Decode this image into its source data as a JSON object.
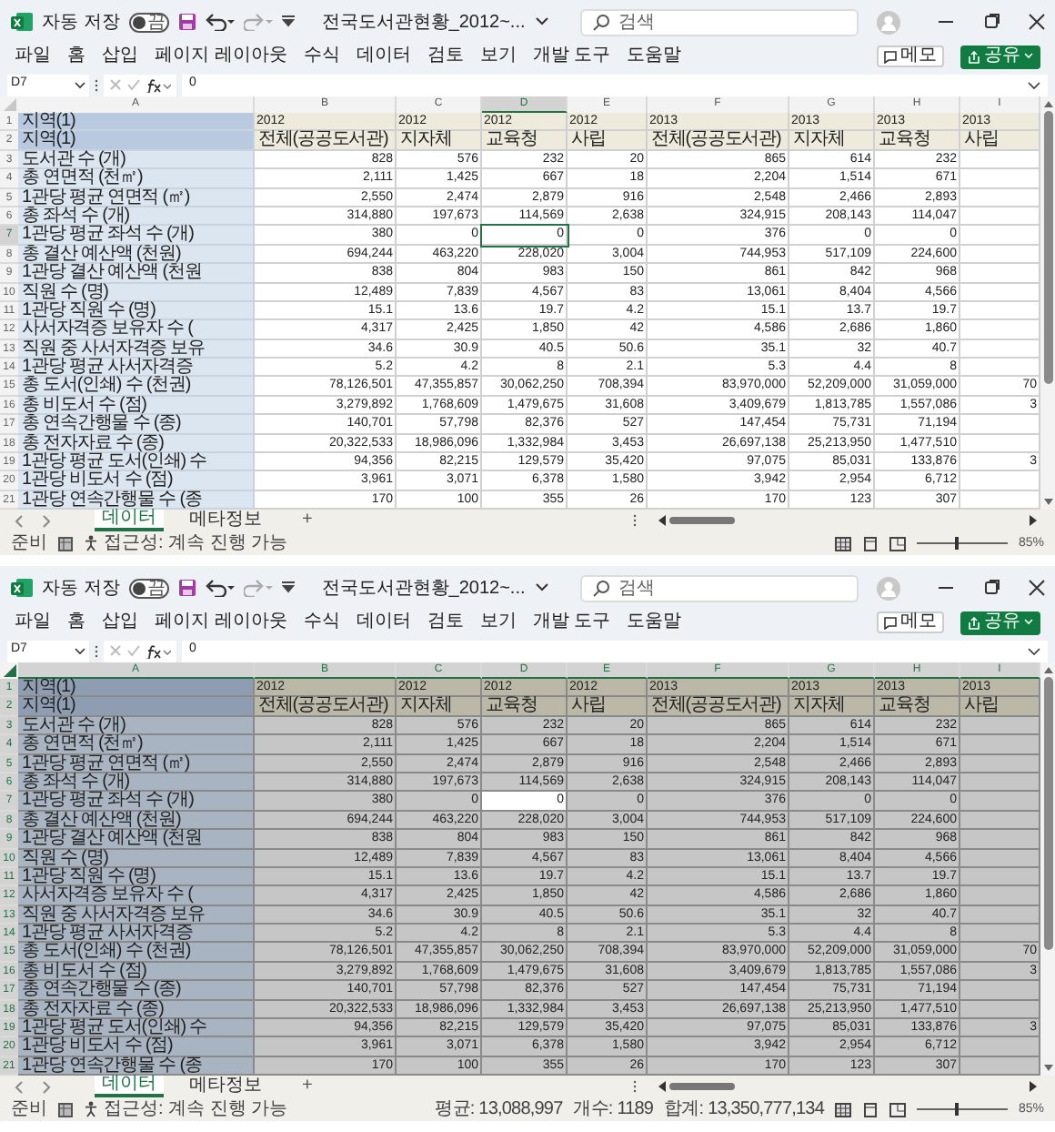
{
  "windows": [
    {
      "title_bar": {
        "autosave_label": "자동 저장",
        "autosave": {
          "on": false,
          "label": "끔"
        },
        "file_name": "전국도서관현황_2012~...",
        "search": {
          "placeholder": "검색"
        }
      },
      "menu": [
        "파일",
        "홈",
        "삽입",
        "페이지 레이아웃",
        "수식",
        "데이터",
        "검토",
        "보기",
        "개발 도구",
        "도움말"
      ],
      "memo_button": "메모",
      "share_button": "공유",
      "name_box": "D7",
      "formula": "0",
      "select_all": false,
      "columns": [
        "A",
        "B",
        "C",
        "D",
        "E",
        "F",
        "G",
        "H",
        "I"
      ],
      "rows": [
        {
          "number": "1",
          "kind": "year_header",
          "label": "지역(1)",
          "cells": [
            "2012",
            "2012",
            "2012",
            "2012",
            "2013",
            "2013",
            "2013",
            "2013"
          ]
        },
        {
          "number": "2",
          "kind": "type_header",
          "label": "지역(1)",
          "cells": [
            "전체(공공도서관)",
            "지자체",
            "교육청",
            "사립",
            "전체(공공도서관)",
            "지자체",
            "교육청",
            "사립"
          ]
        },
        {
          "number": "3",
          "kind": "data",
          "label": "도서관 수 (개)",
          "cells": [
            "828",
            "576",
            "232",
            "20",
            "865",
            "614",
            "232",
            null
          ]
        },
        {
          "number": "4",
          "kind": "data",
          "label": "총 연면적 (천㎡)",
          "cells": [
            "2,111",
            "1,425",
            "667",
            "18",
            "2,204",
            "1,514",
            "671",
            null
          ]
        },
        {
          "number": "5",
          "kind": "data",
          "label": "1관당 평균 연면적 (㎡)",
          "cells": [
            "2,550",
            "2,474",
            "2,879",
            "916",
            "2,548",
            "2,466",
            "2,893",
            null
          ]
        },
        {
          "number": "6",
          "kind": "data",
          "label": "총 좌석 수 (개)",
          "cells": [
            "314,880",
            "197,673",
            "114,569",
            "2,638",
            "324,915",
            "208,143",
            "114,047",
            null
          ]
        },
        {
          "number": "7",
          "kind": "data",
          "label": "1관당 평균 좌석 수 (개)",
          "cells": [
            "380",
            "0",
            "0",
            "0",
            "376",
            "0",
            "0",
            null
          ]
        },
        {
          "number": "8",
          "kind": "data",
          "label": "총 결산 예산액 (천원)",
          "cells": [
            "694,244",
            "463,220",
            "228,020",
            "3,004",
            "744,953",
            "517,109",
            "224,600",
            null
          ]
        },
        {
          "number": "9",
          "kind": "data",
          "label": "1관당 결산 예산액 (천원",
          "cells": [
            "838",
            "804",
            "983",
            "150",
            "861",
            "842",
            "968",
            null
          ]
        },
        {
          "number": "10",
          "kind": "data",
          "label": "직원 수 (명)",
          "cells": [
            "12,489",
            "7,839",
            "4,567",
            "83",
            "13,061",
            "8,404",
            "4,566",
            null
          ]
        },
        {
          "number": "11",
          "kind": "data",
          "label": "1관당 직원 수 (명)",
          "cells": [
            "15.1",
            "13.6",
            "19.7",
            "4.2",
            "15.1",
            "13.7",
            "19.7",
            null
          ]
        },
        {
          "number": "12",
          "kind": "data",
          "label": "사서자격증 보유자 수 (",
          "cells": [
            "4,317",
            "2,425",
            "1,850",
            "42",
            "4,586",
            "2,686",
            "1,860",
            null
          ]
        },
        {
          "number": "13",
          "kind": "data",
          "label": "직원 중 사서자격증 보유",
          "cells": [
            "34.6",
            "30.9",
            "40.5",
            "50.6",
            "35.1",
            "32",
            "40.7",
            null
          ]
        },
        {
          "number": "14",
          "kind": "data",
          "label": "1관당 평균 사서자격증",
          "cells": [
            "5.2",
            "4.2",
            "8",
            "2.1",
            "5.3",
            "4.4",
            "8",
            null
          ]
        },
        {
          "number": "15",
          "kind": "data",
          "label": "총 도서(인쇄) 수 (천권)",
          "cells": [
            "78,126,501",
            "47,355,857",
            "30,062,250",
            "708,394",
            "83,970,000",
            "52,209,000",
            "31,059,000",
            "70"
          ]
        },
        {
          "number": "16",
          "kind": "data",
          "label": "총 비도서 수 (점)",
          "cells": [
            "3,279,892",
            "1,768,609",
            "1,479,675",
            "31,608",
            "3,409,679",
            "1,813,785",
            "1,557,086",
            "3"
          ]
        },
        {
          "number": "17",
          "kind": "data",
          "label": "총 연속간행물 수 (종)",
          "cells": [
            "140,701",
            "57,798",
            "82,376",
            "527",
            "147,454",
            "75,731",
            "71,194",
            null
          ]
        },
        {
          "number": "18",
          "kind": "data",
          "label": "총 전자자료 수 (종)",
          "cells": [
            "20,322,533",
            "18,986,096",
            "1,332,984",
            "3,453",
            "26,697,138",
            "25,213,950",
            "1,477,510",
            null
          ]
        },
        {
          "number": "19",
          "kind": "data",
          "label": "1관당 평균 도서(인쇄) 수",
          "cells": [
            "94,356",
            "82,215",
            "129,579",
            "35,420",
            "97,075",
            "85,031",
            "133,876",
            "3"
          ]
        },
        {
          "number": "20",
          "kind": "data",
          "label": "1관당 비도서 수 (점)",
          "cells": [
            "3,961",
            "3,071",
            "6,378",
            "1,580",
            "3,942",
            "2,954",
            "6,712",
            null
          ]
        },
        {
          "number": "21",
          "kind": "data",
          "label": "1관당 연속간행물 수 (종",
          "cells": [
            "170",
            "100",
            "355",
            "26",
            "170",
            "123",
            "307",
            null
          ]
        }
      ],
      "sheet_tabs": [
        {
          "label": "데이터",
          "selected": true
        },
        {
          "label": "메타정보",
          "selected": false
        }
      ],
      "add_sheet": "+",
      "status": {
        "ready": "준비",
        "accessibility": "접근성: 계속 진행 가능"
      },
      "zoom": {
        "level": 0.42,
        "reading": "85%"
      }
    },
    {
      "title_bar": {
        "autosave_label": "자동 저장",
        "autosave": {
          "on": false,
          "label": "끔"
        },
        "file_name": "전국도서관현황_2012~...",
        "search": {
          "placeholder": "검색"
        }
      },
      "menu": [
        "파일",
        "홈",
        "삽입",
        "페이지 레이아웃",
        "수식",
        "데이터",
        "검토",
        "보기",
        "개발 도구",
        "도움말"
      ],
      "memo_button": "메모",
      "share_button": "공유",
      "name_box": "D7",
      "formula": "0",
      "select_all": true,
      "columns": [
        "A",
        "B",
        "C",
        "D",
        "E",
        "F",
        "G",
        "H",
        "I"
      ],
      "rows": [
        {
          "number": "1",
          "kind": "year_header",
          "label": "지역(1)",
          "cells": [
            "2012",
            "2012",
            "2012",
            "2012",
            "2013",
            "2013",
            "2013",
            "2013"
          ]
        },
        {
          "number": "2",
          "kind": "type_header",
          "label": "지역(1)",
          "cells": [
            "전체(공공도서관)",
            "지자체",
            "교육청",
            "사립",
            "전체(공공도서관)",
            "지자체",
            "교육청",
            "사립"
          ]
        },
        {
          "number": "3",
          "kind": "data",
          "label": "도서관 수 (개)",
          "cells": [
            "828",
            "576",
            "232",
            "20",
            "865",
            "614",
            "232",
            null
          ]
        },
        {
          "number": "4",
          "kind": "data",
          "label": "총 연면적 (천㎡)",
          "cells": [
            "2,111",
            "1,425",
            "667",
            "18",
            "2,204",
            "1,514",
            "671",
            null
          ]
        },
        {
          "number": "5",
          "kind": "data",
          "label": "1관당 평균 연면적 (㎡)",
          "cells": [
            "2,550",
            "2,474",
            "2,879",
            "916",
            "2,548",
            "2,466",
            "2,893",
            null
          ]
        },
        {
          "number": "6",
          "kind": "data",
          "label": "총 좌석 수 (개)",
          "cells": [
            "314,880",
            "197,673",
            "114,569",
            "2,638",
            "324,915",
            "208,143",
            "114,047",
            null
          ]
        },
        {
          "number": "7",
          "kind": "data",
          "label": "1관당 평균 좌석 수 (개)",
          "cells": [
            "380",
            "0",
            "0",
            "0",
            "376",
            "0",
            "0",
            null
          ]
        },
        {
          "number": "8",
          "kind": "data",
          "label": "총 결산 예산액 (천원)",
          "cells": [
            "694,244",
            "463,220",
            "228,020",
            "3,004",
            "744,953",
            "517,109",
            "224,600",
            null
          ]
        },
        {
          "number": "9",
          "kind": "data",
          "label": "1관당 결산 예산액 (천원",
          "cells": [
            "838",
            "804",
            "983",
            "150",
            "861",
            "842",
            "968",
            null
          ]
        },
        {
          "number": "10",
          "kind": "data",
          "label": "직원 수 (명)",
          "cells": [
            "12,489",
            "7,839",
            "4,567",
            "83",
            "13,061",
            "8,404",
            "4,566",
            null
          ]
        },
        {
          "number": "11",
          "kind": "data",
          "label": "1관당 직원 수 (명)",
          "cells": [
            "15.1",
            "13.6",
            "19.7",
            "4.2",
            "15.1",
            "13.7",
            "19.7",
            null
          ]
        },
        {
          "number": "12",
          "kind": "data",
          "label": "사서자격증 보유자 수 (",
          "cells": [
            "4,317",
            "2,425",
            "1,850",
            "42",
            "4,586",
            "2,686",
            "1,860",
            null
          ]
        },
        {
          "number": "13",
          "kind": "data",
          "label": "직원 중 사서자격증 보유",
          "cells": [
            "34.6",
            "30.9",
            "40.5",
            "50.6",
            "35.1",
            "32",
            "40.7",
            null
          ]
        },
        {
          "number": "14",
          "kind": "data",
          "label": "1관당 평균 사서자격증",
          "cells": [
            "5.2",
            "4.2",
            "8",
            "2.1",
            "5.3",
            "4.4",
            "8",
            null
          ]
        },
        {
          "number": "15",
          "kind": "data",
          "label": "총 도서(인쇄) 수 (천권)",
          "cells": [
            "78,126,501",
            "47,355,857",
            "30,062,250",
            "708,394",
            "83,970,000",
            "52,209,000",
            "31,059,000",
            "70"
          ]
        },
        {
          "number": "16",
          "kind": "data",
          "label": "총 비도서 수 (점)",
          "cells": [
            "3,279,892",
            "1,768,609",
            "1,479,675",
            "31,608",
            "3,409,679",
            "1,813,785",
            "1,557,086",
            "3"
          ]
        },
        {
          "number": "17",
          "kind": "data",
          "label": "총 연속간행물 수 (종)",
          "cells": [
            "140,701",
            "57,798",
            "82,376",
            "527",
            "147,454",
            "75,731",
            "71,194",
            null
          ]
        },
        {
          "number": "18",
          "kind": "data",
          "label": "총 전자자료 수 (종)",
          "cells": [
            "20,322,533",
            "18,986,096",
            "1,332,984",
            "3,453",
            "26,697,138",
            "25,213,950",
            "1,477,510",
            null
          ]
        },
        {
          "number": "19",
          "kind": "data",
          "label": "1관당 평균 도서(인쇄) 수",
          "cells": [
            "94,356",
            "82,215",
            "129,579",
            "35,420",
            "97,075",
            "85,031",
            "133,876",
            "3"
          ]
        },
        {
          "number": "20",
          "kind": "data",
          "label": "1관당 비도서 수 (점)",
          "cells": [
            "3,961",
            "3,071",
            "6,378",
            "1,580",
            "3,942",
            "2,954",
            "6,712",
            null
          ]
        },
        {
          "number": "21",
          "kind": "data",
          "label": "1관당 연속간행물 수 (종",
          "cells": [
            "170",
            "100",
            "355",
            "26",
            "170",
            "123",
            "307",
            null
          ]
        }
      ],
      "sheet_tabs": [
        {
          "label": "데이터",
          "selected": true
        },
        {
          "label": "메타정보",
          "selected": false
        }
      ],
      "add_sheet": "+",
      "status": {
        "ready": "준비",
        "accessibility": "접근성: 계속 진행 가능",
        "summary": [
          "평균: 13,088,997",
          "개수: 1189",
          "합계: 13,350,777,134"
        ]
      },
      "zoom": {
        "level": 0.42,
        "reading": "85%"
      }
    }
  ]
}
